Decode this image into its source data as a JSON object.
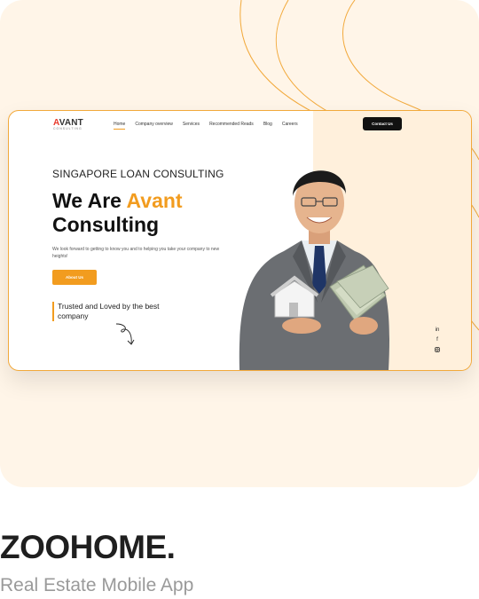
{
  "mockup": {
    "logo_main_a": "A",
    "logo_main_rest": "VANT",
    "logo_sub": "CONSULTING",
    "nav": [
      "Home",
      "Company overview",
      "Services",
      "Recommended Reads",
      "Blog",
      "Careers"
    ],
    "contact_label": "Contact Us",
    "eyebrow": "SINGAPORE LOAN CONSULTING",
    "headline_prefix": "We Are ",
    "headline_accent": "Avant",
    "headline_second": "Consulting",
    "lead": "We look forward to getting to know you and to helping you take your company to new heights!",
    "about_label": "About Us",
    "trusted": "Trusted and Loved by the best company",
    "social_icons": [
      "linkedin-icon",
      "facebook-icon",
      "instagram-icon"
    ]
  },
  "brand": {
    "title": "ZOOHOME.",
    "subtitle": "Real Estate Mobile App"
  },
  "colors": {
    "accent": "#f29c1f",
    "card_bg": "#fff5e8",
    "dark": "#111111"
  }
}
